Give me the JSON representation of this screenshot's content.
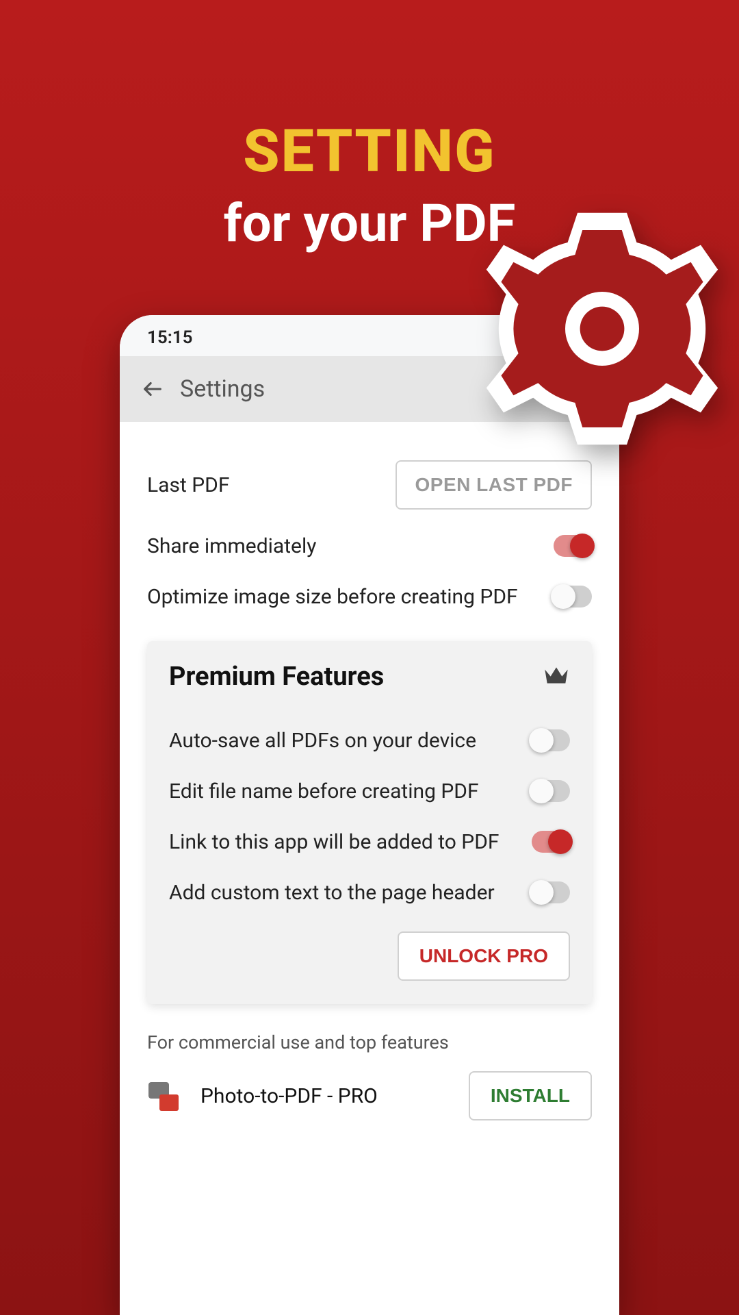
{
  "hero": {
    "title": "SETTING",
    "subtitle": "for your PDF"
  },
  "statusbar": {
    "time": "15:15"
  },
  "appbar": {
    "title": "Settings"
  },
  "settings": {
    "last_pdf_label": "Last PDF",
    "open_last_btn": "OPEN LAST PDF",
    "share_label": "Share immediately",
    "share_on": true,
    "optimize_label": "Optimize image size before creating PDF",
    "optimize_on": false
  },
  "premium": {
    "title": "Premium Features",
    "autosave_label": "Auto-save all PDFs on your device",
    "autosave_on": false,
    "editname_label": "Edit file name before creating PDF",
    "editname_on": false,
    "link_label": "Link to this app will be added to PDF",
    "link_on": true,
    "header_label": "Add custom text to the page header",
    "header_on": false,
    "unlock_btn": "UNLOCK PRO"
  },
  "footer": {
    "caption": "For commercial use and top features",
    "app_name": "Photo-to-PDF - PRO",
    "install_btn": "INSTALL"
  }
}
